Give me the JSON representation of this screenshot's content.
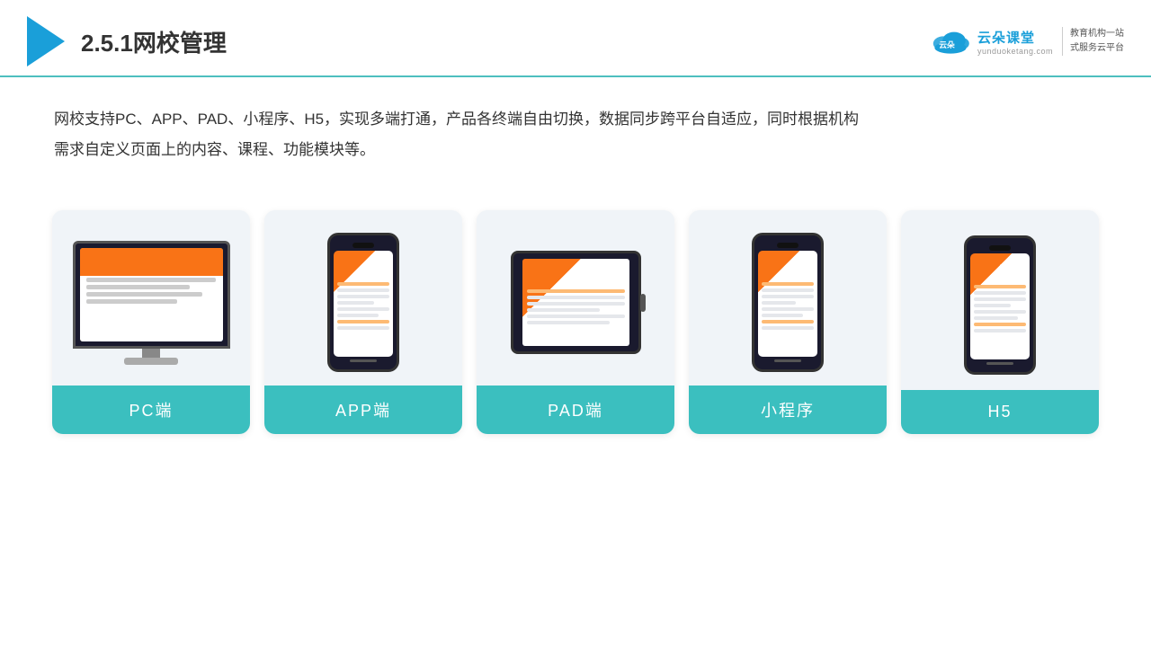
{
  "header": {
    "title": "2.5.1网校管理",
    "brand_name": "云朵课堂",
    "brand_url": "yunduoketang.com",
    "brand_tagline_line1": "教育机构一站",
    "brand_tagline_line2": "式服务云平台"
  },
  "description": {
    "text_line1": "网校支持PC、APP、PAD、小程序、H5，实现多端打通，产品各终端自由切换，数据同步跨平台自适应，同时根据机构",
    "text_line2": "需求自定义页面上的内容、课程、功能模块等。"
  },
  "cards": [
    {
      "id": "pc",
      "label": "PC端"
    },
    {
      "id": "app",
      "label": "APP端"
    },
    {
      "id": "pad",
      "label": "PAD端"
    },
    {
      "id": "miniprogram",
      "label": "小程序"
    },
    {
      "id": "h5",
      "label": "H5"
    }
  ]
}
